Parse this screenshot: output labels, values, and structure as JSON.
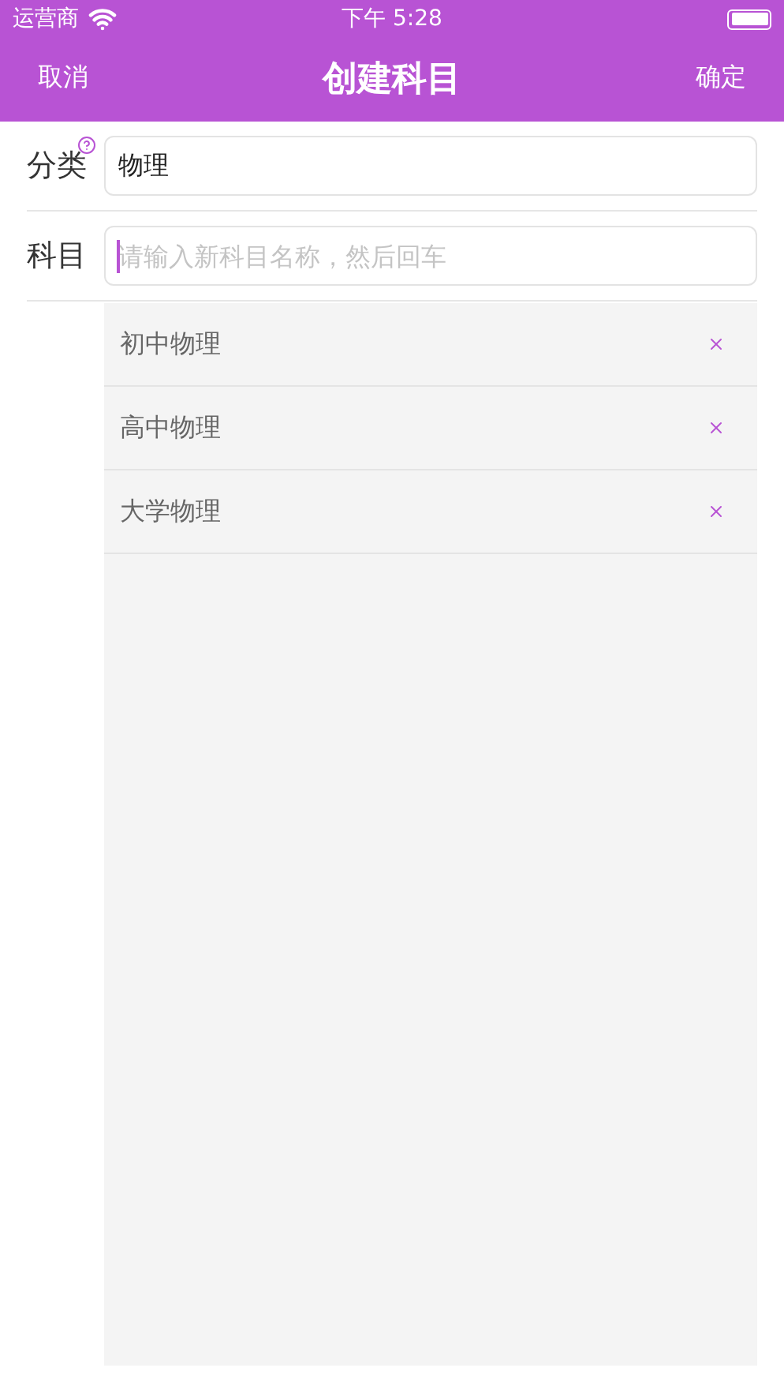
{
  "status_bar": {
    "carrier": "运营商",
    "time": "下午 5:28"
  },
  "nav": {
    "cancel": "取消",
    "title": "创建科目",
    "confirm": "确定"
  },
  "category": {
    "label": "分类",
    "value": "物理"
  },
  "subject": {
    "label": "科目",
    "placeholder": "请输入新科目名称，然后回车",
    "focused": true
  },
  "subjects": [
    {
      "name": "初中物理"
    },
    {
      "name": "高中物理"
    },
    {
      "name": "大学物理"
    }
  ]
}
